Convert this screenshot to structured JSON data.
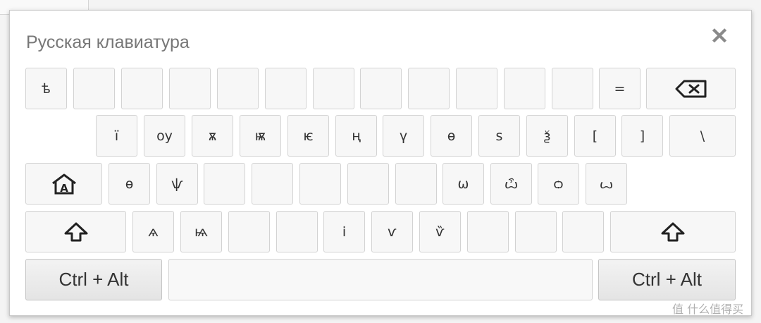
{
  "title": "Русская клавиатура",
  "close_icon": "close-icon",
  "rows": {
    "row1": [
      "ѣ",
      "",
      "",
      "",
      "",
      "",
      "",
      "",
      "",
      "",
      "",
      "",
      "="
    ],
    "row2": [
      "ї",
      "оу",
      "ѫ",
      "ѭ",
      "ѥ",
      "ң",
      "ү",
      "ѳ",
      "ѕ",
      "ѯ",
      "[",
      "]",
      "\\"
    ],
    "row3": [
      "ѳ",
      "ѱ",
      "",
      "",
      "",
      "",
      "",
      "ѡ",
      "ѽ",
      "ѻ",
      "ꙍ",
      ""
    ],
    "row4": [
      "ѧ",
      "ѩ",
      "",
      "",
      "і",
      "ѵ",
      "ѷ",
      "",
      "",
      ""
    ]
  },
  "modifiers": {
    "ctrl_alt_left": "Ctrl + Alt",
    "ctrl_alt_right": "Ctrl + Alt",
    "backspace_icon": "backspace-icon",
    "home_icon": "home-a-icon",
    "shift_icon": "shift-icon"
  },
  "watermark": "值 什么值得买"
}
